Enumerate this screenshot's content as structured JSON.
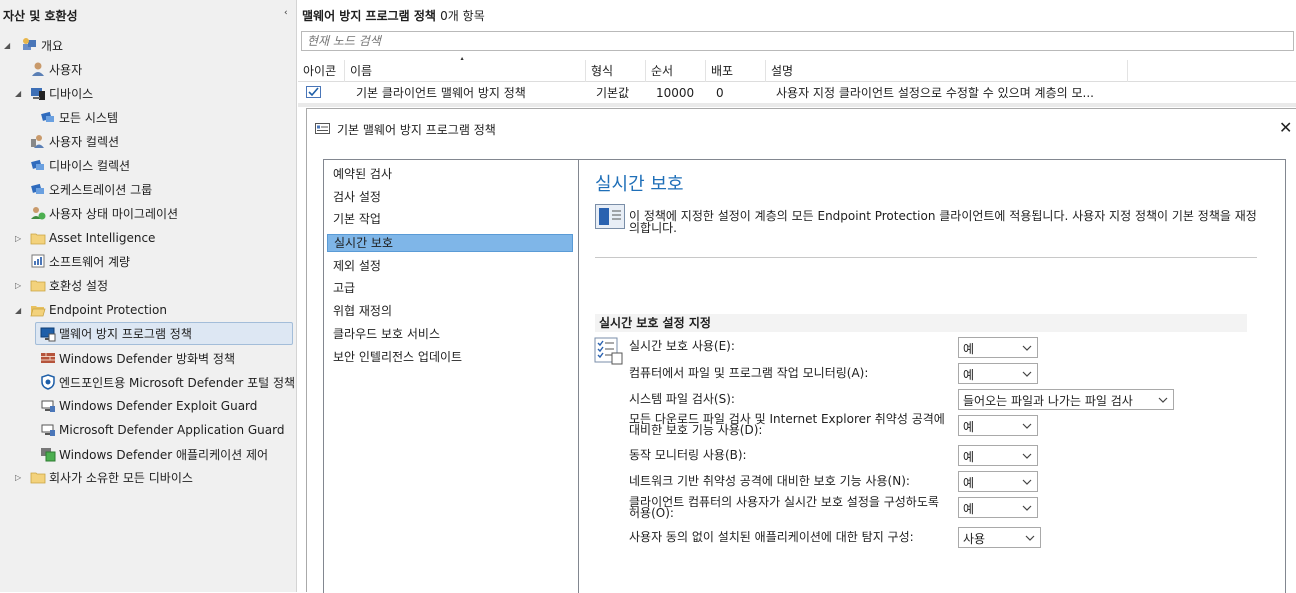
{
  "nav": {
    "title": "자산 및 호환성",
    "collapse_glyph": "‹",
    "items": [
      {
        "label": "개요"
      },
      {
        "label": "사용자"
      },
      {
        "label": "디바이스"
      },
      {
        "label": "모든 시스템"
      },
      {
        "label": "사용자 컬렉션"
      },
      {
        "label": "디바이스 컬렉션"
      },
      {
        "label": "오케스트레이션 그룹"
      },
      {
        "label": "사용자 상태 마이그레이션"
      },
      {
        "label": "Asset Intelligence"
      },
      {
        "label": "소프트웨어 계량"
      },
      {
        "label": "호환성 설정"
      },
      {
        "label": "Endpoint Protection"
      },
      {
        "label": "맬웨어 방지 프로그램 정책"
      },
      {
        "label": "Windows Defender 방화벽 정책"
      },
      {
        "label": "엔드포인트용 Microsoft Defender 포털 정책"
      },
      {
        "label": "Windows Defender Exploit Guard"
      },
      {
        "label": "Microsoft Defender Application Guard"
      },
      {
        "label": "Windows Defender 애플리케이션 제어"
      },
      {
        "label": "회사가 소유한 모든 디바이스"
      }
    ]
  },
  "list": {
    "title": "맬웨어 방지 프로그램 정책",
    "count": "0개 항목",
    "search_placeholder": "현재 노드 검색",
    "columns": [
      "아이콘",
      "이름",
      "형식",
      "순서",
      "배포",
      "설명"
    ],
    "rows": [
      {
        "name": "기본 클라이언트 맬웨어 방지 정책",
        "type": "기본값",
        "order": "10000",
        "deploy": "0",
        "desc": "사용자 지정 클라이언트 설정으로 수정할 수 있으며 계층의 모..."
      }
    ]
  },
  "dialog": {
    "title": "기본 맬웨어 방지 프로그램 정책",
    "nav": [
      "예약된 검사",
      "검사 설정",
      "기본 작업",
      "실시간 보호",
      "제외 설정",
      "고급",
      "위협 재정의",
      "클라우드 보호 서비스",
      "보안 인텔리전스 업데이트"
    ],
    "heading": "실시간 보호",
    "info": "이 정책에 지정한 설정이 계층의 모든 Endpoint Protection 클라이언트에 적용됩니다. 사용자 지정 정책이 기본 정책을 재정의합니다.",
    "section_title": "실시간 보호 설정 지정",
    "settings": [
      {
        "label": "실시간 보호 사용(E):",
        "value": "예"
      },
      {
        "label": "컴퓨터에서 파일 및 프로그램 작업 모니터링(A):",
        "value": "예"
      },
      {
        "label": "시스템 파일 검사(S):",
        "value": "들어오는 파일과 나가는 파일 검사"
      },
      {
        "label": "모든 다운로드 파일 검사 및 Internet Explorer 취약성 공격에 대비한 보호 기능 사용(D):",
        "value": "예"
      },
      {
        "label": "동작 모니터링 사용(B):",
        "value": "예"
      },
      {
        "label": "네트워크 기반 취약성 공격에 대비한 보호 기능 사용(N):",
        "value": "예"
      },
      {
        "label": "클라이언트 컴퓨터의 사용자가 실시간 보호 설정을 구성하도록 허용(O):",
        "value": "예"
      },
      {
        "label": "사용자 동의 없이 설치된 애플리케이션에 대한 탐지 구성:",
        "value": "사용"
      }
    ]
  }
}
